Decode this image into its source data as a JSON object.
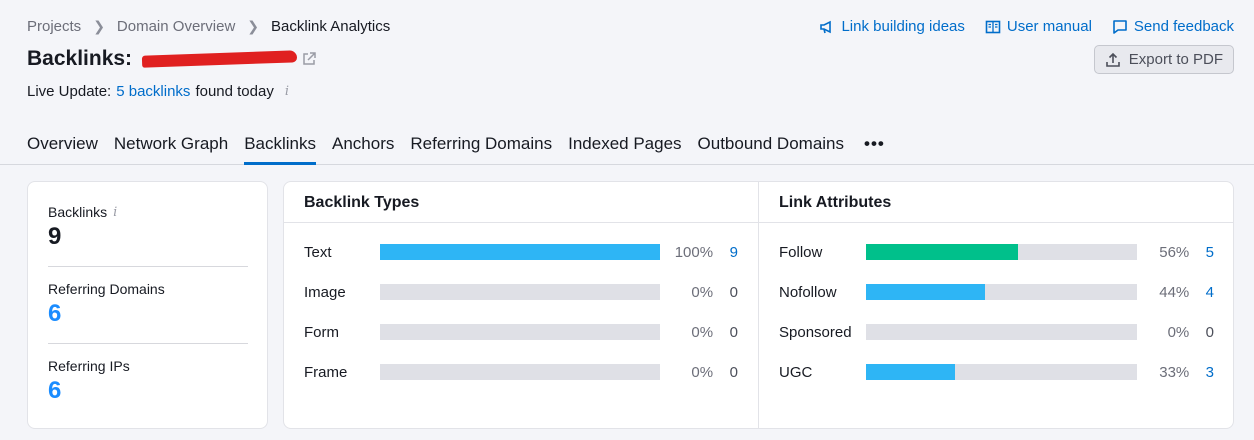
{
  "breadcrumb": {
    "items": [
      "Projects",
      "Domain Overview",
      "Backlink Analytics"
    ]
  },
  "header_links": {
    "ideas": "Link building ideas",
    "manual": "User manual",
    "feedback": "Send feedback"
  },
  "title": "Backlinks:",
  "export_label": "Export to PDF",
  "live_update": {
    "prefix": "Live Update:",
    "link": "5 backlinks",
    "suffix": "found today"
  },
  "tabs": [
    {
      "label": "Overview",
      "active": false
    },
    {
      "label": "Network Graph",
      "active": false
    },
    {
      "label": "Backlinks",
      "active": true
    },
    {
      "label": "Anchors",
      "active": false
    },
    {
      "label": "Referring Domains",
      "active": false
    },
    {
      "label": "Indexed Pages",
      "active": false
    },
    {
      "label": "Outbound Domains",
      "active": false
    }
  ],
  "tab_more": "•••",
  "summary": {
    "backlinks": {
      "label": "Backlinks",
      "value": "9"
    },
    "referring_domains": {
      "label": "Referring Domains",
      "value": "6"
    },
    "referring_ips": {
      "label": "Referring IPs",
      "value": "6"
    }
  },
  "backlink_types": {
    "title": "Backlink Types",
    "rows": [
      {
        "label": "Text",
        "percent": "100%",
        "count": "9",
        "fraction": 1.0
      },
      {
        "label": "Image",
        "percent": "0%",
        "count": "0",
        "fraction": 0
      },
      {
        "label": "Form",
        "percent": "0%",
        "count": "0",
        "fraction": 0
      },
      {
        "label": "Frame",
        "percent": "0%",
        "count": "0",
        "fraction": 0
      }
    ]
  },
  "link_attributes": {
    "title": "Link Attributes",
    "rows": [
      {
        "label": "Follow",
        "percent": "56%",
        "count": "5",
        "fraction": 0.56
      },
      {
        "label": "Nofollow",
        "percent": "44%",
        "count": "4",
        "fraction": 0.44
      },
      {
        "label": "Sponsored",
        "percent": "0%",
        "count": "0",
        "fraction": 0
      },
      {
        "label": "UGC",
        "percent": "33%",
        "count": "3",
        "fraction": 0.33
      }
    ]
  },
  "colors": {
    "accent": "#006dca",
    "bar_blue": "#2eb5f5",
    "bar_green": "#00c08b",
    "bar_track": "#dfe0e6"
  }
}
